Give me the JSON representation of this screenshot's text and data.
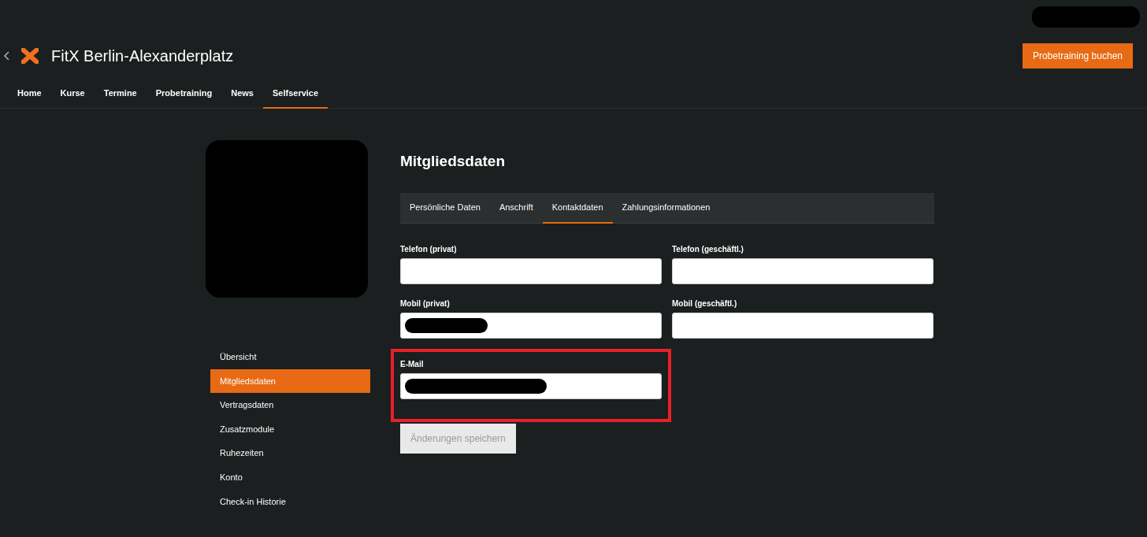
{
  "header": {
    "user_redacted": true,
    "club_name": "FitX Berlin-Alexanderplatz",
    "cta_button": "Probetraining buchen"
  },
  "nav": [
    {
      "label": "Home",
      "selected": false
    },
    {
      "label": "Kurse",
      "selected": false
    },
    {
      "label": "Termine",
      "selected": false
    },
    {
      "label": "Probetraining",
      "selected": false
    },
    {
      "label": "News",
      "selected": false
    },
    {
      "label": "Selfservice",
      "selected": true
    }
  ],
  "sidebar": {
    "avatar_redacted": true,
    "items": [
      {
        "label": "Übersicht",
        "selected": false
      },
      {
        "label": "Mitgliedsdaten",
        "selected": true
      },
      {
        "label": "Vertragsdaten",
        "selected": false
      },
      {
        "label": "Zusatzmodule",
        "selected": false
      },
      {
        "label": "Ruhezeiten",
        "selected": false
      },
      {
        "label": "Konto",
        "selected": false
      },
      {
        "label": "Check-in Historie",
        "selected": false
      }
    ]
  },
  "page_title": "Mitgliedsdaten",
  "tabs": [
    {
      "label": "Persönliche Daten",
      "selected": false
    },
    {
      "label": "Anschrift",
      "selected": false
    },
    {
      "label": "Kontaktdaten",
      "selected": true
    },
    {
      "label": "Zahlungsinformationen",
      "selected": false
    }
  ],
  "fields": [
    {
      "label": "Telefon (privat)",
      "redacted": false,
      "highlighted": false
    },
    {
      "label": "Telefon (geschäftl.)",
      "redacted": false,
      "highlighted": false
    },
    {
      "label": "Mobil (privat)",
      "redacted": true,
      "highlighted": false
    },
    {
      "label": "Mobil (geschäftl.)",
      "redacted": false,
      "highlighted": false
    },
    {
      "label": "E-Mail",
      "redacted": true,
      "highlighted": true
    }
  ],
  "save_button": {
    "label": "Änderungen speichern",
    "disabled": true
  }
}
